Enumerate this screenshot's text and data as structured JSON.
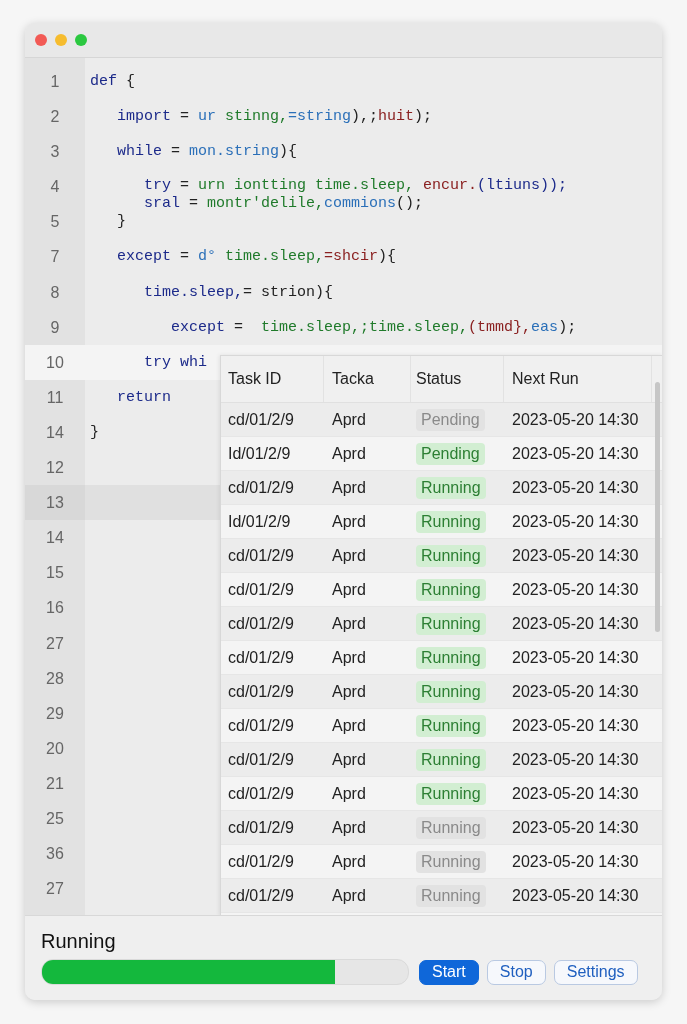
{
  "editor": {
    "lines": [
      {
        "number": "1",
        "active": false,
        "marked": false,
        "tokens": [
          {
            "text": "def",
            "color": "#1c2a8a"
          },
          {
            "text": " {",
            "color": "#222222"
          }
        ]
      },
      {
        "number": "2",
        "active": false,
        "marked": false,
        "tokens": [
          {
            "text": "   import",
            "color": "#1c2a8a"
          },
          {
            "text": " = ",
            "color": "#222222"
          },
          {
            "text": "ur",
            "color": "#2a6fb8"
          },
          {
            "text": " stinng,",
            "color": "#1f7a2a"
          },
          {
            "text": "=string",
            "color": "#2a6fb8"
          },
          {
            "text": "),;",
            "color": "#222222"
          },
          {
            "text": "huit",
            "color": "#8a2020"
          },
          {
            "text": ");",
            "color": "#222222"
          }
        ]
      },
      {
        "number": "3",
        "active": false,
        "marked": false,
        "tokens": [
          {
            "text": "   while",
            "color": "#1c2a8a"
          },
          {
            "text": " = ",
            "color": "#222222"
          },
          {
            "text": "mon.string",
            "color": "#2a6fb8"
          },
          {
            "text": "){",
            "color": "#222222"
          }
        ]
      },
      {
        "number": "4",
        "active": false,
        "marked": false,
        "tokens": [
          {
            "text": "      try",
            "color": "#1c2a8a"
          },
          {
            "text": " = ",
            "color": "#222222"
          },
          {
            "text": "urn iontting time.sleep,",
            "color": "#1f7a2a"
          },
          {
            "text": " encur.",
            "color": "#8a2020"
          },
          {
            "text": "(ltiuns));",
            "color": "#1c2a8a"
          }
        ],
        "continuation": [
          {
            "text": "      sral",
            "color": "#1c2a8a"
          },
          {
            "text": " = ",
            "color": "#222222"
          },
          {
            "text": "montr'delile,",
            "color": "#1f7a2a"
          },
          {
            "text": "commions",
            "color": "#2a6fb8"
          },
          {
            "text": "();",
            "color": "#222222"
          }
        ]
      },
      {
        "number": "5",
        "active": false,
        "marked": false,
        "tokens": [
          {
            "text": "   }",
            "color": "#222222"
          }
        ]
      },
      {
        "number": "7",
        "active": false,
        "marked": false,
        "tokens": [
          {
            "text": "   except",
            "color": "#1c2a8a"
          },
          {
            "text": " = ",
            "color": "#222222"
          },
          {
            "text": "d°",
            "color": "#2a6fb8"
          },
          {
            "text": " time.sleep,",
            "color": "#1f7a2a"
          },
          {
            "text": "=shcir",
            "color": "#8a2020"
          },
          {
            "text": "){",
            "color": "#222222"
          }
        ]
      },
      {
        "number": "8",
        "active": false,
        "marked": false,
        "tokens": [
          {
            "text": "      time.sleep,",
            "color": "#1c2a8a"
          },
          {
            "text": "= strion){",
            "color": "#222222"
          }
        ]
      },
      {
        "number": "9",
        "active": false,
        "marked": false,
        "tokens": [
          {
            "text": "         except",
            "color": "#1c2a8a"
          },
          {
            "text": " =  ",
            "color": "#222222"
          },
          {
            "text": "time.sleep,;time.sleep,",
            "color": "#1f7a2a"
          },
          {
            "text": "(tmmd},",
            "color": "#8a2020"
          },
          {
            "text": "eas",
            "color": "#2a6fb8"
          },
          {
            "text": ");",
            "color": "#222222"
          }
        ]
      },
      {
        "number": "10",
        "active": true,
        "marked": false,
        "tokens": [
          {
            "text": "      try whi",
            "color": "#1c2a8a"
          }
        ]
      },
      {
        "number": "11",
        "active": false,
        "marked": false,
        "tokens": [
          {
            "text": "   return",
            "color": "#1c2a8a"
          }
        ]
      },
      {
        "number": "14",
        "active": false,
        "marked": false,
        "tokens": [
          {
            "text": "}",
            "color": "#222222"
          }
        ]
      },
      {
        "number": "12",
        "active": false,
        "marked": false
      },
      {
        "number": "13",
        "active": false,
        "marked": true
      },
      {
        "number": "14",
        "active": false,
        "marked": false
      },
      {
        "number": "15",
        "active": false,
        "marked": false
      },
      {
        "number": "16",
        "active": false,
        "marked": false
      },
      {
        "number": "27",
        "active": false,
        "marked": false
      },
      {
        "number": "28",
        "active": false,
        "marked": false
      },
      {
        "number": "29",
        "active": false,
        "marked": false
      },
      {
        "number": "20",
        "active": false,
        "marked": false
      },
      {
        "number": "21",
        "active": false,
        "marked": false
      },
      {
        "number": "25",
        "active": false,
        "marked": false
      },
      {
        "number": "36",
        "active": false,
        "marked": false
      },
      {
        "number": "27",
        "active": false,
        "marked": false
      }
    ]
  },
  "task_table": {
    "columns": [
      "Task ID",
      "Tackа",
      "Status",
      "Next Run"
    ],
    "rows": [
      {
        "task_id": "cd/01/2/9",
        "task": "Aprd",
        "status": "Pending",
        "active": false,
        "next_run": "2023-05-20 14:30"
      },
      {
        "task_id": "Id/01/2/9",
        "task": "Aprd",
        "status": "Pending",
        "active": true,
        "next_run": "2023-05-20 14:30"
      },
      {
        "task_id": "cd/01/2/9",
        "task": "Aprd",
        "status": "Running",
        "active": true,
        "next_run": "2023-05-20 14:30"
      },
      {
        "task_id": "Id/01/2/9",
        "task": "Aprd",
        "status": "Running",
        "active": true,
        "next_run": "2023-05-20 14:30"
      },
      {
        "task_id": "cd/01/2/9",
        "task": "Aprd",
        "status": "Running",
        "active": true,
        "next_run": "2023-05-20 14:30"
      },
      {
        "task_id": "cd/01/2/9",
        "task": "Aprd",
        "status": "Running",
        "active": true,
        "next_run": "2023-05-20 14:30"
      },
      {
        "task_id": "cd/01/2/9",
        "task": "Aprd",
        "status": "Running",
        "active": true,
        "next_run": "2023-05-20 14:30"
      },
      {
        "task_id": "cd/01/2/9",
        "task": "Aprd",
        "status": "Running",
        "active": true,
        "next_run": "2023-05-20 14:30"
      },
      {
        "task_id": "cd/01/2/9",
        "task": "Aprd",
        "status": "Running",
        "active": true,
        "next_run": "2023-05-20 14:30"
      },
      {
        "task_id": "cd/01/2/9",
        "task": "Aprd",
        "status": "Running",
        "active": true,
        "next_run": "2023-05-20 14:30"
      },
      {
        "task_id": "cd/01/2/9",
        "task": "Aprd",
        "status": "Running",
        "active": true,
        "next_run": "2023-05-20 14:30"
      },
      {
        "task_id": "cd/01/2/9",
        "task": "Aprd",
        "status": "Running",
        "active": true,
        "next_run": "2023-05-20 14:30"
      },
      {
        "task_id": "cd/01/2/9",
        "task": "Aprd",
        "status": "Running",
        "active": false,
        "next_run": "2023-05-20 14:30"
      },
      {
        "task_id": "cd/01/2/9",
        "task": "Aprd",
        "status": "Running",
        "active": false,
        "next_run": "2023-05-20 14:30"
      },
      {
        "task_id": "cd/01/2/9",
        "task": "Aprd",
        "status": "Running",
        "active": false,
        "next_run": "2023-05-20 14:30"
      }
    ]
  },
  "status_bar": {
    "label": "Running",
    "progress": {
      "level": 0.8
    },
    "buttons": [
      {
        "label": "Start",
        "primary": true
      },
      {
        "label": "Stop",
        "primary": false
      },
      {
        "label": "Settings",
        "primary": false
      }
    ]
  }
}
